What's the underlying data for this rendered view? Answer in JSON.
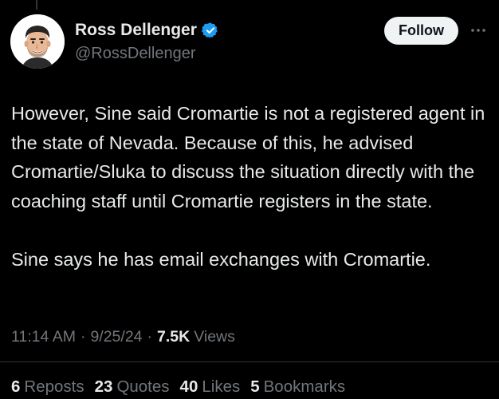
{
  "author": {
    "display_name": "Ross Dellenger",
    "handle": "@RossDellenger",
    "verified": true,
    "verified_color": "#1d9bf0",
    "avatar_icon": "cartoon-avatar-icon"
  },
  "actions": {
    "follow_label": "Follow",
    "more_icon": "more-options-icon"
  },
  "tweet": {
    "paragraphs": [
      "However, Sine said Cromartie is not a registered agent in the state of Nevada. Because of this, he advised Cromartie/Sluka to discuss the situation directly with the coaching staff until Cromartie registers in the state.",
      "Sine says he has email exchanges with Cromartie."
    ]
  },
  "meta": {
    "time": "11:14 AM",
    "separator": "·",
    "date": "9/25/24",
    "views_count": "7.5K",
    "views_label": "Views"
  },
  "stats": {
    "reposts": {
      "count": "6",
      "label": "Reposts"
    },
    "quotes": {
      "count": "23",
      "label": "Quotes"
    },
    "likes": {
      "count": "40",
      "label": "Likes"
    },
    "bookmarks": {
      "count": "5",
      "label": "Bookmarks"
    }
  },
  "colors": {
    "background": "#000000",
    "primary_text": "#e7e9ea",
    "secondary_text": "#71767b",
    "follow_button_bg": "#eff3f4",
    "divider": "#2f3336"
  }
}
